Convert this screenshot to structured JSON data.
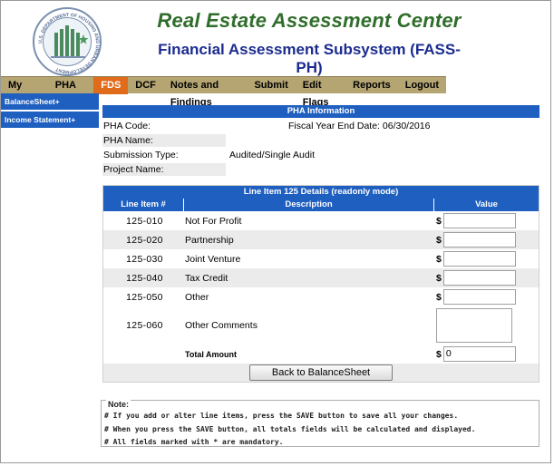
{
  "header": {
    "title": "Real Estate Assessment Center",
    "subtitle": "Financial Assessment Subsystem (FASS-PH)",
    "seal_text": "U.S. DEPARTMENT OF HOUSING AND URBAN DEVELOPMENT"
  },
  "nav": {
    "items": [
      "My Inbox",
      "PHA Info",
      "FDS",
      "DCF",
      "Notes and Findings",
      "Submit",
      "Edit Flags",
      "Reports",
      "Logout"
    ],
    "active": "FDS"
  },
  "sidebar": {
    "items": [
      "BalanceSheet+",
      "Income Statement+"
    ]
  },
  "pha_info": {
    "heading": "PHA Information",
    "pha_code_label": "PHA Code:",
    "fiscal_year_end": "Fiscal Year End Date: 06/30/2016",
    "pha_name_label": "PHA Name:",
    "submission_type_label": "Submission Type:",
    "submission_type_value": "Audited/Single Audit",
    "project_name_label": "Project Name:"
  },
  "details": {
    "heading": "Line Item 125 Details (readonly mode)",
    "columns": [
      "Line Item #",
      "Description",
      "Value"
    ],
    "rows": [
      {
        "item": "125-010",
        "description": "Not For Profit",
        "value": ""
      },
      {
        "item": "125-020",
        "description": "Partnership",
        "value": ""
      },
      {
        "item": "125-030",
        "description": "Joint Venture",
        "value": ""
      },
      {
        "item": "125-040",
        "description": "Tax Credit",
        "value": ""
      },
      {
        "item": "125-050",
        "description": "Other",
        "value": ""
      }
    ],
    "comments_item": "125-060",
    "comments_label": "Other Comments",
    "total_label": "Total Amount",
    "total_value": "0",
    "currency": "$",
    "back_button": "Back to BalanceSheet"
  },
  "note": {
    "heading": "Note:",
    "lines": [
      "# If you add or alter line items, press the SAVE button to save all your changes.",
      "# When you press the SAVE button, all totals fields will be calculated and displayed.",
      "# All fields marked with * are mandatory."
    ]
  },
  "colors": {
    "nav_bg": "#b5a572",
    "nav_active": "#e06b1a",
    "panel_blue": "#1e5fc0",
    "title_green": "#2f6d2a",
    "title_navy": "#1c2c8f"
  }
}
